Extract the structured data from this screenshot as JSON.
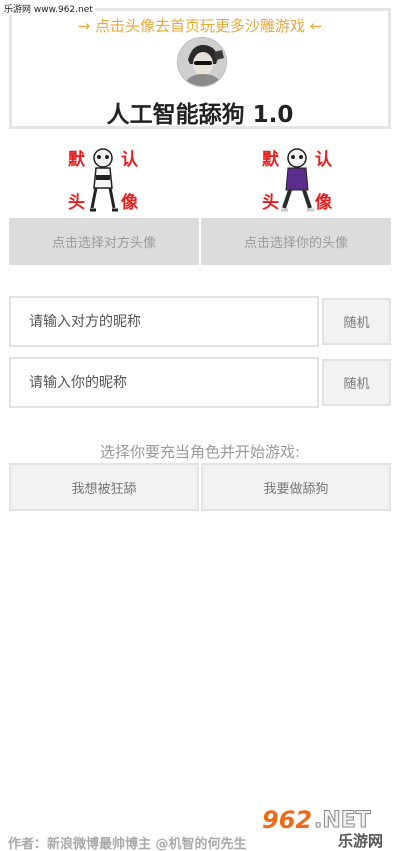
{
  "watermark": {
    "top_text": "乐游网 www.962.net",
    "brand_num": "962",
    "brand_net": ".NET",
    "brand_cn": "乐游网"
  },
  "header": {
    "banner": "→ 点击头像去首页玩更多沙雕游戏 ←",
    "title": "人工智能舔狗 1.0"
  },
  "default_avatars": {
    "label_chars": [
      "默",
      "认",
      "头",
      "像"
    ]
  },
  "avatar_select": {
    "other_label": "点击选择对方头像",
    "self_label": "点击选择你的头像"
  },
  "nickname": {
    "other_placeholder": "请输入对方的昵称",
    "self_placeholder": "请输入你的昵称",
    "random_label": "随机"
  },
  "role": {
    "prompt": "选择你要充当角色并开始游戏:",
    "be_licked": "我想被狂舔",
    "be_dog": "我要做舔狗"
  },
  "footer": {
    "author": "作者：新浪微博最帅博主 @机智的何先生"
  },
  "colors": {
    "banner": "#e8a93a",
    "label_red": "#e81e1e",
    "button_gray": "#dcdcdc"
  }
}
